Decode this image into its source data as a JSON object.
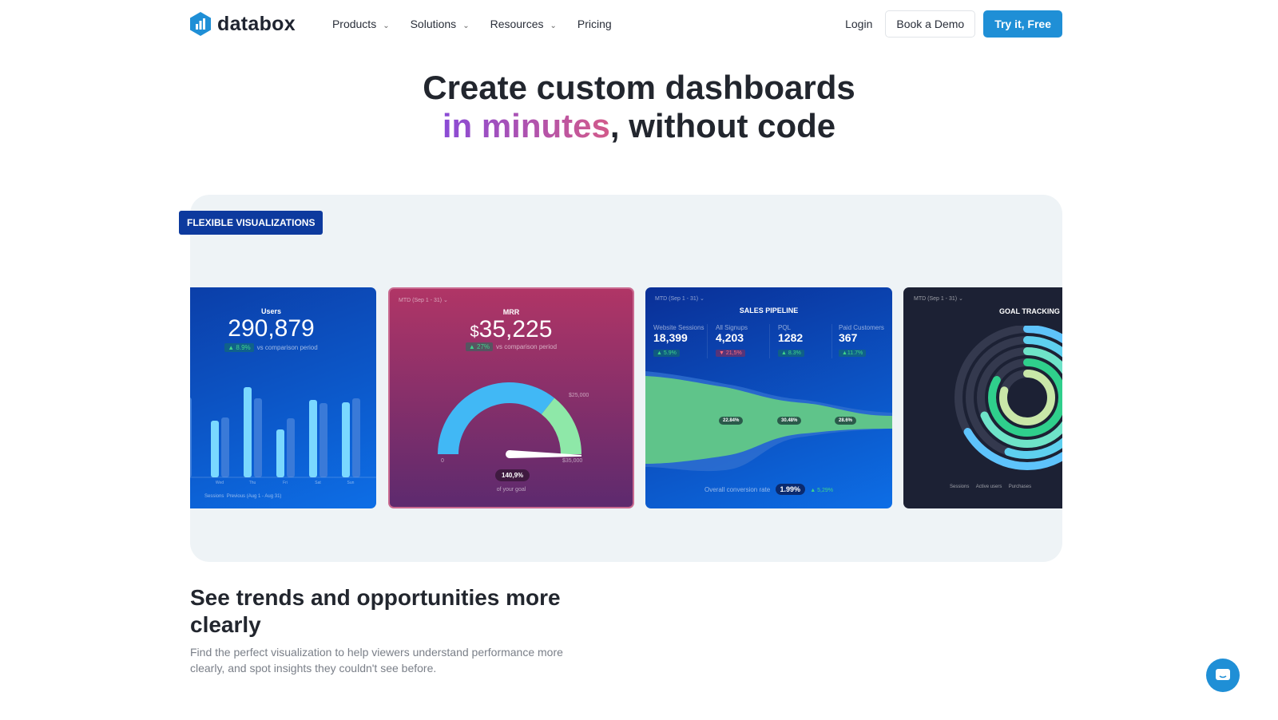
{
  "nav": {
    "brand": "databox",
    "menu": [
      {
        "label": "Products"
      },
      {
        "label": "Solutions"
      },
      {
        "label": "Resources"
      },
      {
        "label": "Pricing"
      }
    ],
    "login": "Login",
    "demo": "Book a Demo",
    "try": "Try it, Free",
    "accent": "#1f8fd6"
  },
  "hero": {
    "line1": "Create custom dashboards",
    "highlight": "in minutes",
    "rest": ", without code"
  },
  "badge": "FLEXIBLE VISUALIZATIONS",
  "cards": {
    "users": {
      "title": "Users",
      "value": "290,879",
      "change": "▲ 8.9%",
      "compare": "vs comparison period",
      "days": [
        "Wed",
        "Thu",
        "Fri",
        "Sat",
        "Sun"
      ],
      "current": [
        71,
        113,
        60,
        97,
        94
      ],
      "previous": [
        75,
        99,
        74,
        93,
        99
      ],
      "legend": [
        "Sessions",
        "Previous (Aug 1 - Aug 31)"
      ]
    },
    "mrr": {
      "period": "MTD (Sep 1 - 31) ⌄",
      "title": "MRR",
      "currency": "$",
      "value": "35,225",
      "change": "▲ 27%",
      "compare": "vs comparison period",
      "min": "0",
      "goal_label": "$25,000",
      "max": "$35,000",
      "pct": "140,9%",
      "pct_label": "of your goal",
      "gauge_value": 35225,
      "gauge_goal": 25000,
      "gauge_max": 35000
    },
    "pipeline": {
      "period": "MTD (Sep 1 - 31) ⌄",
      "title": "SALES PIPELINE",
      "stages": [
        {
          "label": "Website Sessions",
          "value": "18,399",
          "change": "▲ 5.9%",
          "up": true
        },
        {
          "label": "All Signups",
          "value": "4,203",
          "change": "▼ 21,5%",
          "up": false
        },
        {
          "label": "PQL",
          "value": "1282",
          "change": "▲ 8.3%",
          "up": true
        },
        {
          "label": "Paid Customers",
          "value": "367",
          "change": "▲11.7%",
          "up": true
        }
      ],
      "rates": [
        "22.84%",
        "30.48%",
        "28.6%"
      ],
      "overall_label": "Overall conversion rate",
      "overall": "1.99%",
      "overall_change": "▲ 5,29%"
    },
    "goal": {
      "period": "MTD (Sep 1 - 31) ⌄",
      "title": "GOAL TRACKING",
      "legend": [
        "Sessions",
        "Active users",
        "Purchases"
      ]
    }
  },
  "section": {
    "title": "See trends and opportunities more clearly",
    "text": "Find the perfect visualization to help viewers understand performance more clearly, and spot insights they couldn't see before."
  }
}
